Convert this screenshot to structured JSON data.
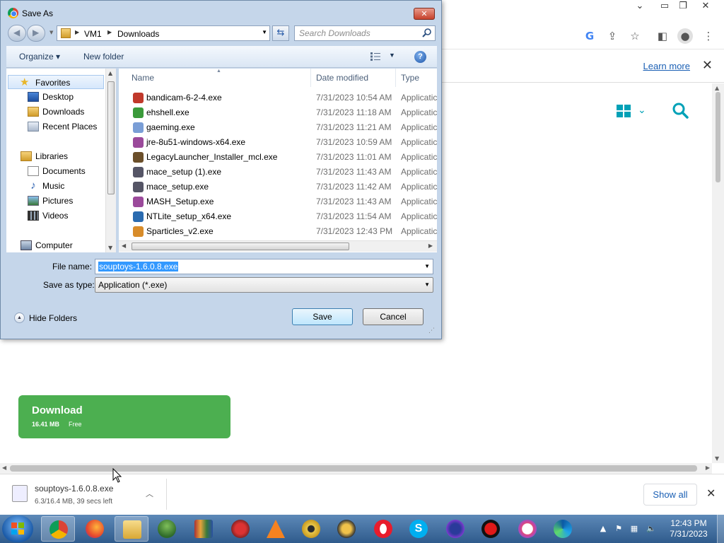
{
  "browser": {
    "learn_more": "Learn more",
    "site_download": {
      "label": "Download",
      "size": "16.41 MB",
      "price": "Free"
    }
  },
  "dialog": {
    "title": "Save As",
    "breadcrumb": [
      "VM1",
      "Downloads"
    ],
    "search_placeholder": "Search Downloads",
    "toolbar": {
      "organize": "Organize",
      "new_folder": "New folder"
    },
    "nav": {
      "favorites": "Favorites",
      "desktop": "Desktop",
      "downloads": "Downloads",
      "recent_places": "Recent Places",
      "libraries": "Libraries",
      "documents": "Documents",
      "music": "Music",
      "pictures": "Pictures",
      "videos": "Videos",
      "computer": "Computer"
    },
    "columns": {
      "name": "Name",
      "date_modified": "Date modified",
      "type": "Type"
    },
    "files": [
      {
        "name": "bandicam-6-2-4.exe",
        "date": "7/31/2023 10:54 AM",
        "type": "Applicatic",
        "icon": "bandicam-icon",
        "color": "#c0392b"
      },
      {
        "name": "ehshell.exe",
        "date": "7/31/2023 11:18 AM",
        "type": "Applicatic",
        "icon": "media-center-icon",
        "color": "#3a9a3a"
      },
      {
        "name": "gaeming.exe",
        "date": "7/31/2023 11:21 AM",
        "type": "Applicatic",
        "icon": "installer-icon",
        "color": "#7a9ed6"
      },
      {
        "name": "jre-8u51-windows-x64.exe",
        "date": "7/31/2023 10:59 AM",
        "type": "Applicatic",
        "icon": "winrar-icon",
        "color": "#9b4a9b"
      },
      {
        "name": "LegacyLauncher_Installer_mcl.exe",
        "date": "7/31/2023 11:01 AM",
        "type": "Applicatic",
        "icon": "minecraft-block-icon",
        "color": "#6b4f2a"
      },
      {
        "name": "mace_setup (1).exe",
        "date": "7/31/2023 11:43 AM",
        "type": "Applicatic",
        "icon": "setup-icon",
        "color": "#556"
      },
      {
        "name": "mace_setup.exe",
        "date": "7/31/2023 11:42 AM",
        "type": "Applicatic",
        "icon": "setup-icon",
        "color": "#556"
      },
      {
        "name": "MASH_Setup.exe",
        "date": "7/31/2023 11:43 AM",
        "type": "Applicatic",
        "icon": "winrar-icon",
        "color": "#9b4a9b"
      },
      {
        "name": "NTLite_setup_x64.exe",
        "date": "7/31/2023 11:54 AM",
        "type": "Applicatic",
        "icon": "download-arrow-icon",
        "color": "#2a6bb0"
      },
      {
        "name": "Sparticles_v2.exe",
        "date": "7/31/2023 12:43 PM",
        "type": "Applicatic",
        "icon": "sparticles-icon",
        "color": "#d88c2a"
      }
    ],
    "file_name_label": "File name:",
    "file_name_value": "souptoys-1.6.0.8.exe",
    "save_as_type_label": "Save as type:",
    "save_as_type_value": "Application (*.exe)",
    "hide_folders": "Hide Folders",
    "save": "Save",
    "cancel": "Cancel"
  },
  "shelf": {
    "file_name": "souptoys-1.6.0.8.exe",
    "progress": "6.3/16.4 MB, 39 secs left",
    "show_all": "Show all"
  },
  "taskbar": {
    "apps": [
      "chrome",
      "firefox",
      "file-explorer",
      "tree-app",
      "winrar",
      "spider-app",
      "vlc",
      "eye-app",
      "bird-app",
      "opera",
      "skype",
      "headphones-app",
      "record-app",
      "itunes",
      "edge"
    ],
    "time": "12:43 PM",
    "date": "7/31/2023"
  }
}
